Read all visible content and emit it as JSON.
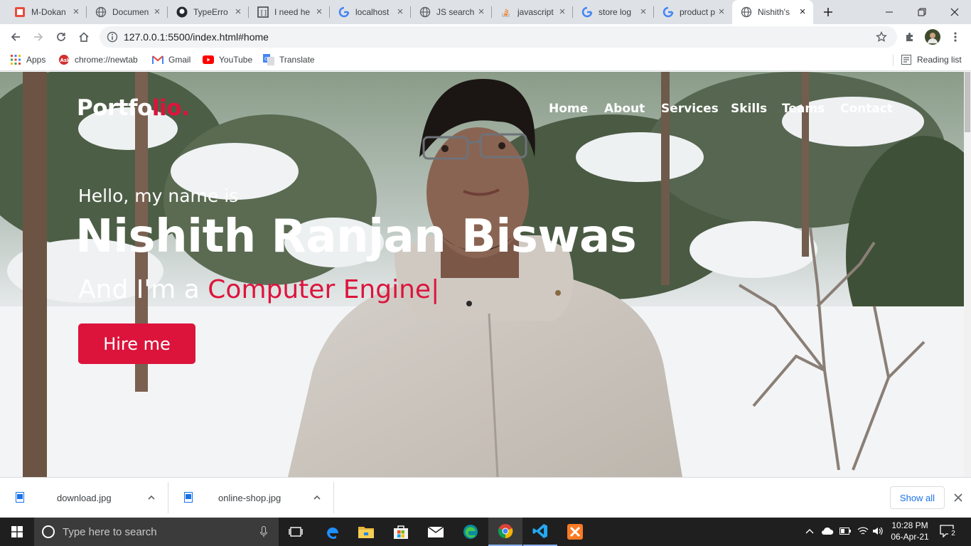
{
  "browser": {
    "tabs": [
      {
        "title": "M-Dokan",
        "icon": "m-dokan-favicon"
      },
      {
        "title": "Documen",
        "icon": "globe-icon"
      },
      {
        "title": "TypeErro",
        "icon": "github-icon"
      },
      {
        "title": "I need he",
        "icon": "bracket-icon"
      },
      {
        "title": "localhost",
        "icon": "google-icon"
      },
      {
        "title": "JS search",
        "icon": "globe-icon"
      },
      {
        "title": "javascript",
        "icon": "stackoverflow-icon"
      },
      {
        "title": "store log",
        "icon": "google-icon"
      },
      {
        "title": "product p",
        "icon": "google-icon"
      },
      {
        "title": "Nishith's",
        "icon": "globe-icon"
      }
    ],
    "url": "127.0.0.1:5500/index.html#home",
    "bookmarks": [
      {
        "label": "Apps",
        "icon": "apps-grid-icon"
      },
      {
        "label": "chrome://newtab",
        "icon": "ask-icon"
      },
      {
        "label": "Gmail",
        "icon": "gmail-icon"
      },
      {
        "label": "YouTube",
        "icon": "youtube-icon"
      },
      {
        "label": "Translate",
        "icon": "translate-icon"
      }
    ],
    "reading_list": "Reading list"
  },
  "site": {
    "logo_main": "Portfo",
    "logo_accent": "lio.",
    "nav": [
      "Home",
      "About",
      "Services",
      "Skills",
      "Teams",
      "Contact"
    ],
    "hello": "Hello, my name is",
    "name": "Nishith Ranjan Biswas",
    "role_prefix": "And I'm a ",
    "role_typed": "Computer Engine",
    "cursor": "|",
    "hire_button": "Hire me",
    "accent_color": "#dc143c"
  },
  "downloads": {
    "items": [
      "download.jpg",
      "online-shop.jpg"
    ],
    "show_all": "Show all"
  },
  "taskbar": {
    "search_placeholder": "Type here to search",
    "time": "10:28 PM",
    "date": "06-Apr-21",
    "notification_count": "2"
  }
}
